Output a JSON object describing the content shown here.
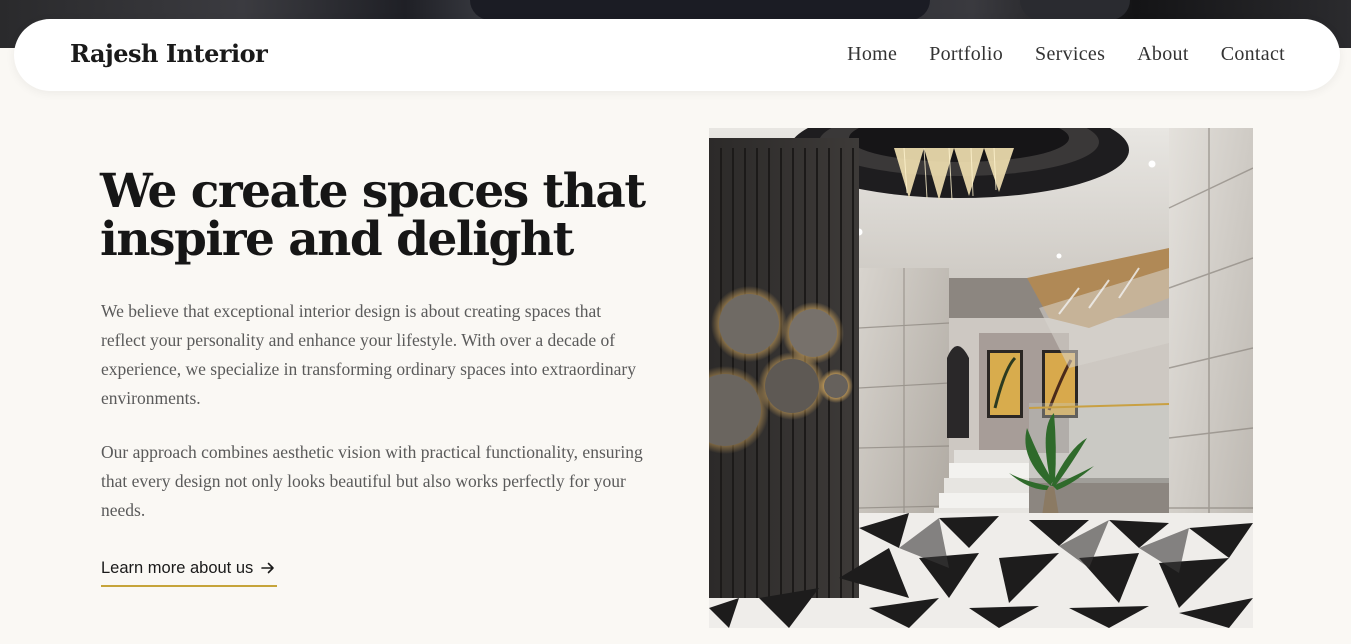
{
  "brand": {
    "name": "Rajesh Interior"
  },
  "nav": {
    "items": [
      {
        "label": "Home"
      },
      {
        "label": "Portfolio"
      },
      {
        "label": "Services"
      },
      {
        "label": "About"
      },
      {
        "label": "Contact"
      }
    ]
  },
  "hero": {
    "headline": "We create spaces that inspire and delight",
    "paragraphs": [
      "We believe that exceptional interior design is about creating spaces that reflect your personality and enhance your lifestyle. With over a decade of experience, we specialize in transforming ordinary spaces into extraordinary environments.",
      "Our approach combines aesthetic vision with practical functionality, ensuring that every design not only looks beautiful but also works perfectly for your needs."
    ],
    "cta_label": "Learn more about us",
    "cta_icon": "arrow-right-icon",
    "image_icon": "interior-photo"
  },
  "colors": {
    "background": "#faf8f4",
    "heading": "#161616",
    "body_text": "#5a5a5a",
    "accent": "#c6a43a",
    "nav_background": "#ffffff"
  }
}
